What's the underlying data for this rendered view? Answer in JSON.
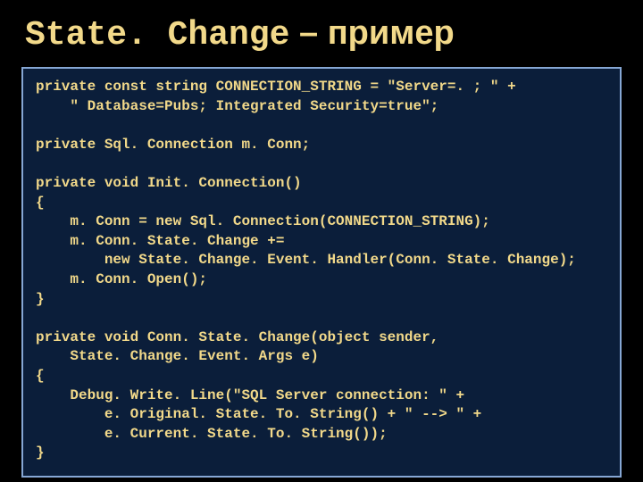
{
  "title": {
    "mono": "State. Change",
    "dash": " – ",
    "word": "пример"
  },
  "code": "private const string CONNECTION_STRING = \"Server=. ; \" +\n    \" Database=Pubs; Integrated Security=true\";\n\nprivate Sql. Connection m. Conn;\n\nprivate void Init. Connection()\n{\n    m. Conn = new Sql. Connection(CONNECTION_STRING);\n    m. Conn. State. Change +=\n        new State. Change. Event. Handler(Conn. State. Change);\n    m. Conn. Open();\n}\n\nprivate void Conn. State. Change(object sender,\n    State. Change. Event. Args e)\n{\n    Debug. Write. Line(\"SQL Server connection: \" +\n        e. Original. State. To. String() + \" --> \" +\n        e. Current. State. To. String());\n}"
}
